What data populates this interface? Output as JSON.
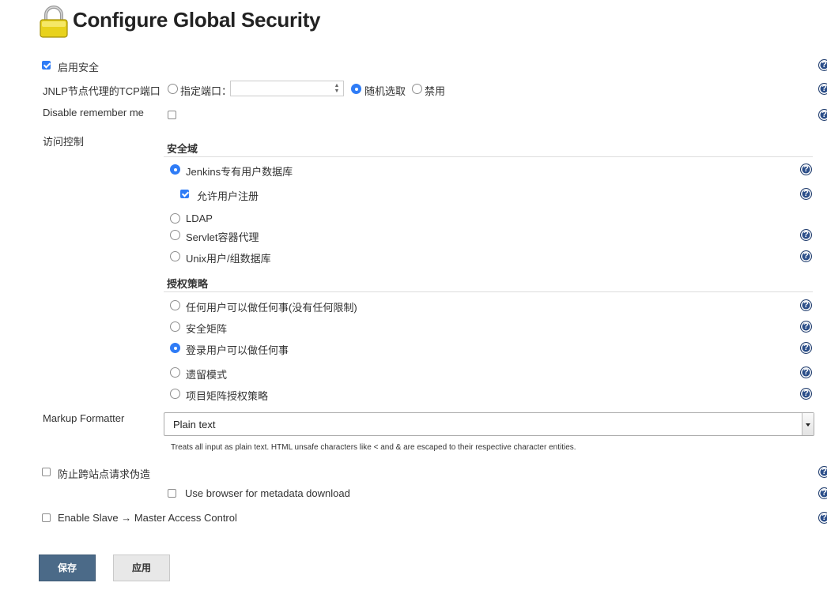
{
  "page": {
    "title": "Configure Global Security",
    "title_icon": "lock-icon"
  },
  "enable_security": {
    "label": "启用安全",
    "checked": true
  },
  "jnlp": {
    "label": "JNLP节点代理的TCP端口",
    "fixed_label": "指定端口：",
    "port_value": "",
    "random_label": "随机选取",
    "disable_label": "禁用",
    "selected": "random"
  },
  "remember_me": {
    "label": "Disable remember me",
    "checked": false
  },
  "access_control": {
    "label": "访问控制",
    "realm": {
      "heading": "安全域",
      "options": [
        {
          "label": "Jenkins专有用户数据库",
          "selected": true
        },
        {
          "label": "LDAP",
          "selected": false
        },
        {
          "label": "Servlet容器代理",
          "selected": false
        },
        {
          "label": "Unix用户/组数据库",
          "selected": false
        }
      ],
      "allow_signup": {
        "label": "允许用户注册",
        "checked": true
      }
    },
    "authorization": {
      "heading": "授权策略",
      "options": [
        {
          "label": "任何用户可以做任何事(没有任何限制)",
          "selected": false
        },
        {
          "label": "安全矩阵",
          "selected": false
        },
        {
          "label": "登录用户可以做任何事",
          "selected": true
        },
        {
          "label": "遗留模式",
          "selected": false
        },
        {
          "label": "项目矩阵授权策略",
          "selected": false
        }
      ]
    }
  },
  "markup_formatter": {
    "label": "Markup Formatter",
    "selected": "Plain text",
    "description": "Treats all input as plain text. HTML unsafe characters like < and & are escaped to their respective character entities."
  },
  "csrf": {
    "label": "防止跨站点请求伪造",
    "checked": false
  },
  "browser_metadata": {
    "label": "Use browser for metadata download",
    "checked": false
  },
  "slave_master": {
    "label": "Enable Slave → Master Access Control",
    "checked": false
  },
  "buttons": {
    "save": "保存",
    "apply": "应用"
  },
  "help_icon_glyph": "?",
  "colors": {
    "accent": "#2f7cf6",
    "save_button": "#4b6a88",
    "help_icon": "#2c4f8a"
  }
}
